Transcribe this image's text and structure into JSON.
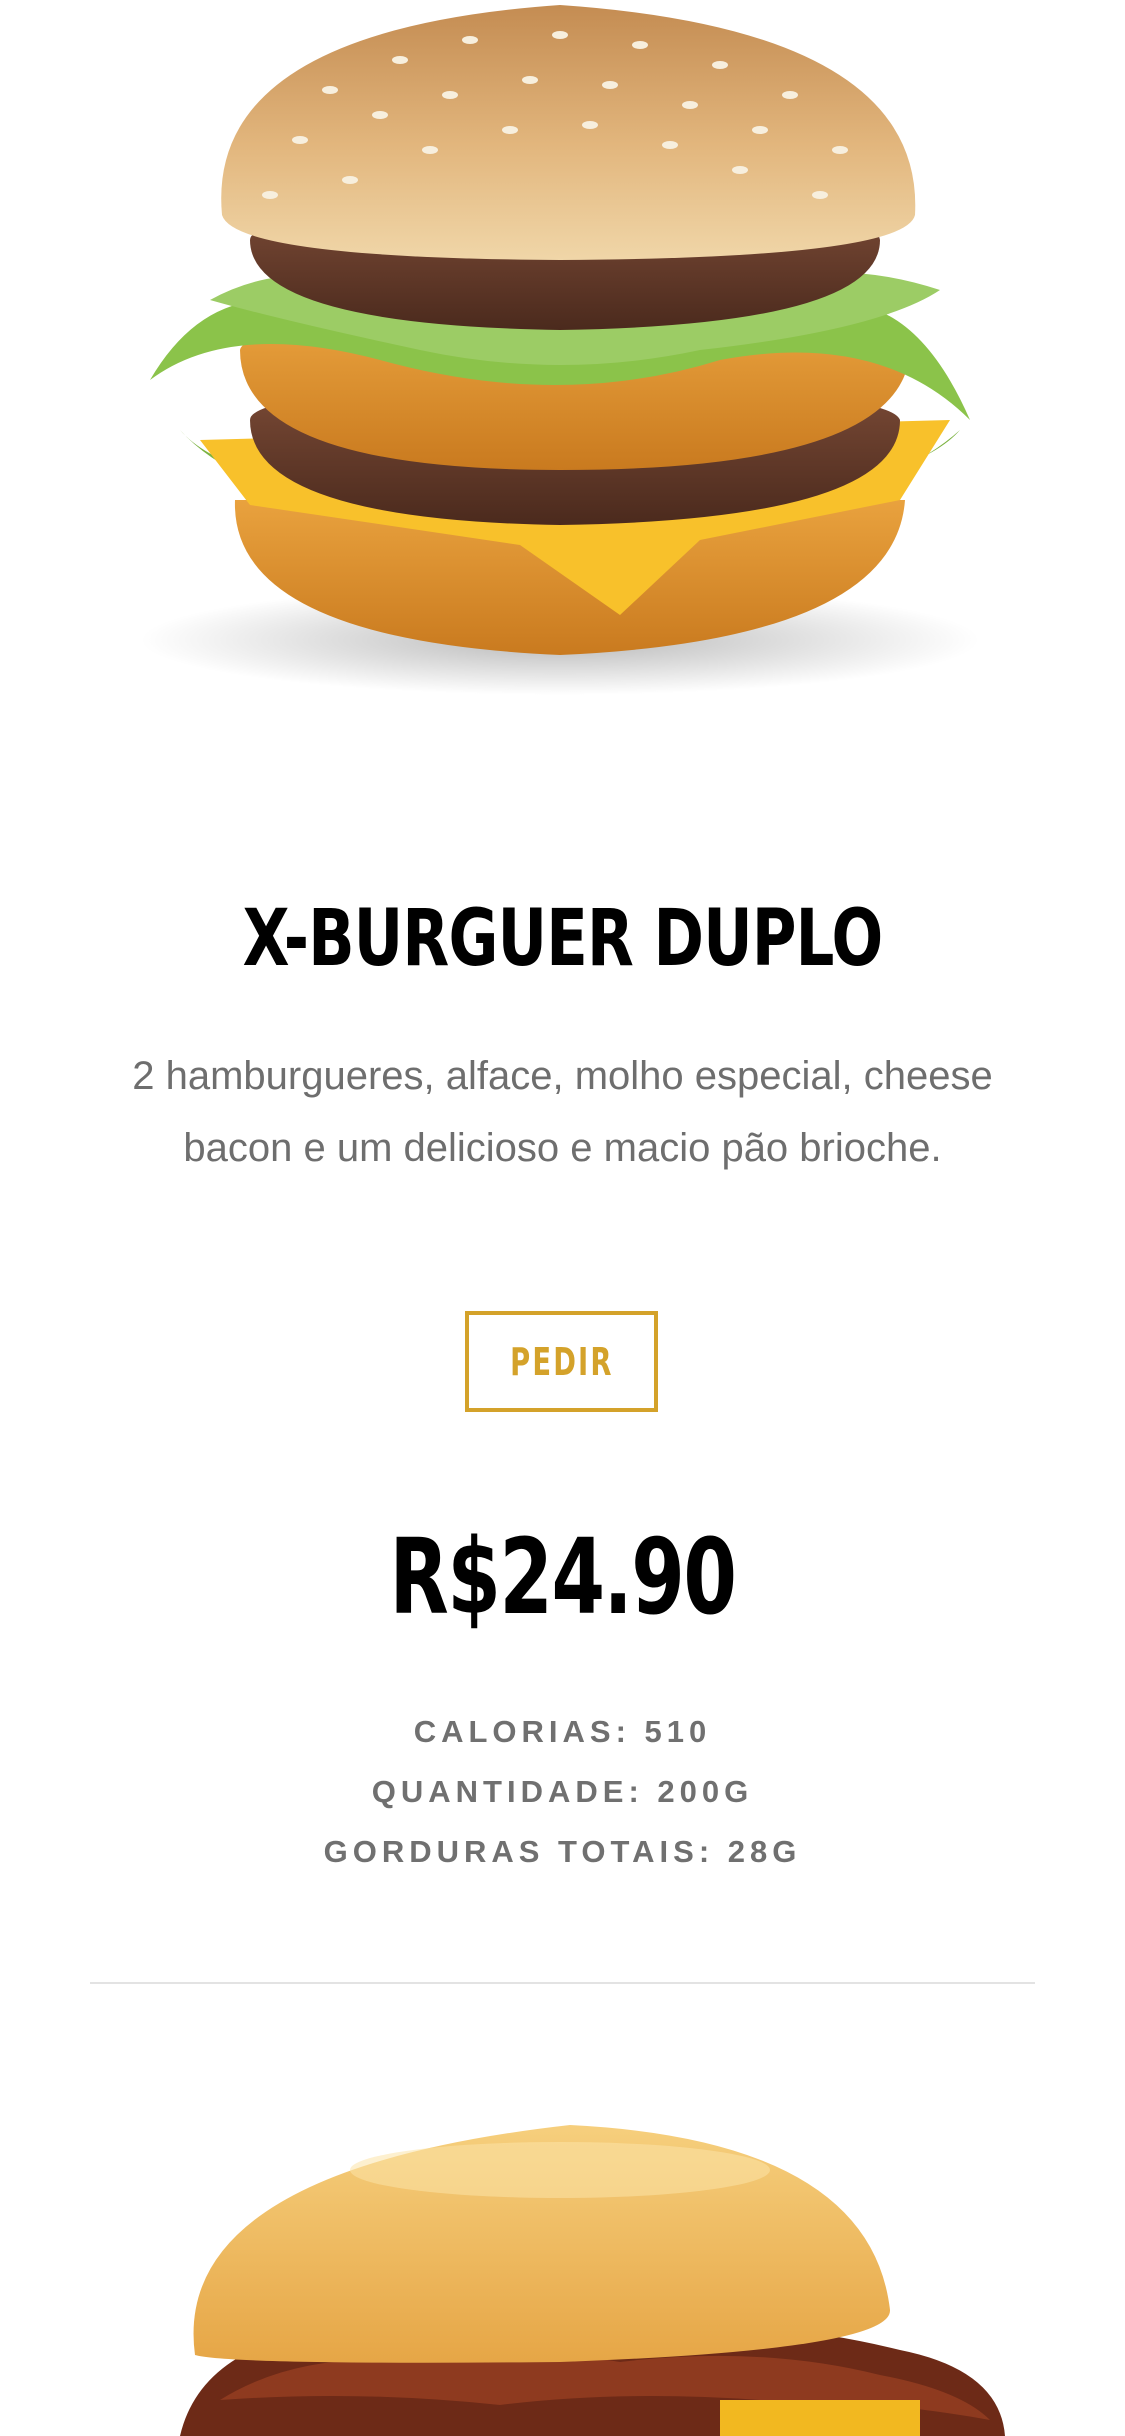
{
  "products": [
    {
      "image_name": "double-burger-photo",
      "title": "X-BURGUER DUPLO",
      "description": "2 hamburgueres, alface, molho especial, cheese bacon e um delicioso e macio pão brioche.",
      "order_label": "PEDIR",
      "price": "R$24.90",
      "nutrition": [
        "CALORIAS: 510",
        "QUANTIDADE: 200G",
        "GORDURAS TOTAIS: 28G"
      ]
    },
    {
      "image_name": "bacon-burger-photo"
    }
  ],
  "colors": {
    "accent": "#d4a22a",
    "title": "#000000",
    "body_text": "#6e6e6e",
    "divider": "#e3e3e3"
  }
}
